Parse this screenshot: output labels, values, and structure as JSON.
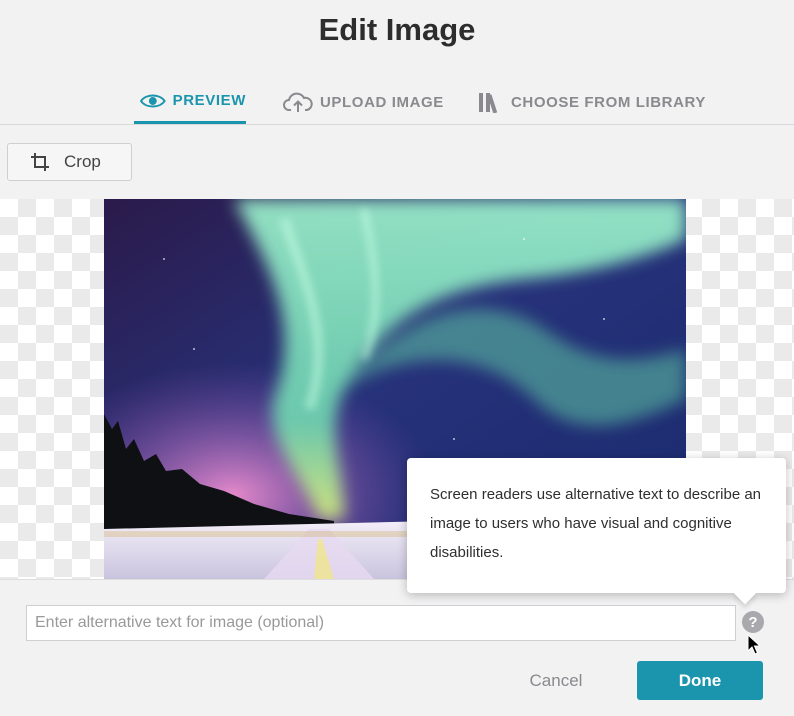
{
  "dialog": {
    "title": "Edit Image"
  },
  "tabs": [
    {
      "label": "PREVIEW",
      "icon": "eye-icon",
      "active": true
    },
    {
      "label": "UPLOAD IMAGE",
      "icon": "cloud-upload-icon",
      "active": false
    },
    {
      "label": "CHOOSE FROM LIBRARY",
      "icon": "library-icon",
      "active": false
    }
  ],
  "toolbar": {
    "crop_label": "Crop",
    "crop_icon": "crop-icon"
  },
  "preview": {
    "image_subject": "aurora borealis over snowy road",
    "background": "transparency-checkerboard"
  },
  "tooltip": {
    "text": "Screen readers use alternative text to describe an image to users who have visual and cognitive disabilities."
  },
  "alt_text": {
    "value": "",
    "placeholder": "Enter alternative text for image (optional)",
    "help_icon": "question-icon",
    "help_label": "?"
  },
  "actions": {
    "cancel_label": "Cancel",
    "done_label": "Done"
  },
  "colors": {
    "accent": "#1b95ad",
    "background": "#f2f2f3",
    "muted": "#8a8a8e"
  }
}
